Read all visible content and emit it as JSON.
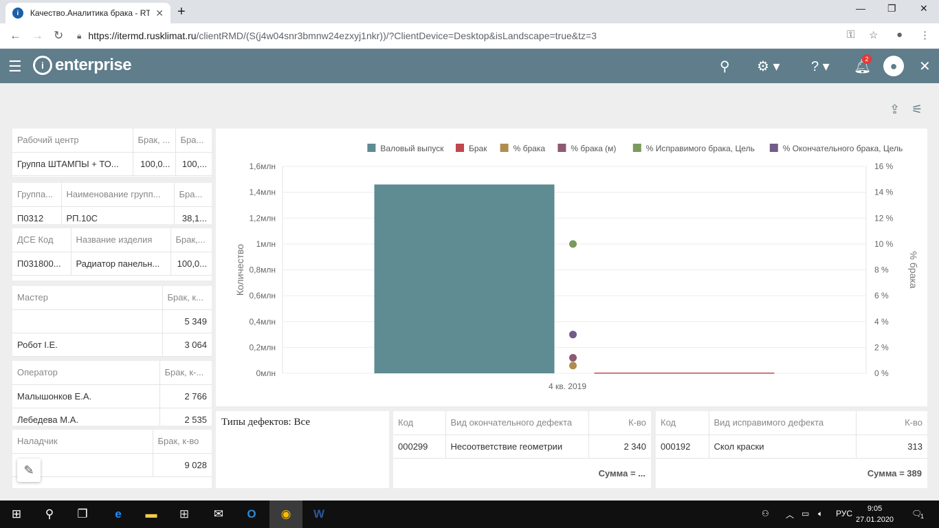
{
  "browser": {
    "tab_title": "Качество.Аналитика брака - RTF",
    "url_host": "https://itermd.rusklimat.ru",
    "url_path": "/clientRMD/(S(j4w04snr3bmnw24ezxyj1nkr))/?ClientDevice=Desktop&isLandscape=true&tz=3"
  },
  "app": {
    "logo_text": "enterprise",
    "notification_count": "2"
  },
  "panels": {
    "work_center": {
      "headers": [
        "Рабочий центр",
        "Брак, ...",
        "Бра..."
      ],
      "rows": [
        [
          "Группа ШТАМПЫ + ТО...",
          "100,0...",
          "100,..."
        ]
      ]
    },
    "group": {
      "headers": [
        "Группа...",
        "Наименование групп...",
        "Бра..."
      ],
      "rows": [
        [
          "П0312",
          "РП.10С",
          "38,1..."
        ]
      ]
    },
    "dse": {
      "headers": [
        "ДСЕ Код",
        "Название изделия",
        "Брак,..."
      ],
      "rows": [
        [
          "П031800...",
          "Радиатор панельн...",
          "100,0..."
        ]
      ]
    },
    "master": {
      "headers": [
        "Мастер",
        "Брак, к..."
      ],
      "rows": [
        [
          "",
          "5 349"
        ],
        [
          "Робот I.E.",
          "3 064"
        ]
      ]
    },
    "operator": {
      "headers": [
        "Оператор",
        "Брак, к-..."
      ],
      "rows": [
        [
          "Малышонков Е.А.",
          "2 766"
        ],
        [
          "Лебедева М.А.",
          "2 535"
        ]
      ]
    },
    "adjuster": {
      "headers": [
        "Наладчик",
        "Брак, к-во"
      ],
      "rows": [
        [
          "",
          "9 028"
        ]
      ]
    }
  },
  "filter": {
    "text": "Типы дефектов: Все"
  },
  "final_defects": {
    "headers": [
      "Код",
      "Вид окончательного дефекта",
      "К-во"
    ],
    "rows": [
      [
        "000299",
        "Несоответствие геометрии",
        "2 340"
      ]
    ],
    "sum": "Сумма = ..."
  },
  "fixable_defects": {
    "headers": [
      "Код",
      "Вид исправимого дефекта",
      "К-во"
    ],
    "rows": [
      [
        "000192",
        "Скол краски",
        "313"
      ]
    ],
    "sum": "Сумма = 389"
  },
  "chart_data": {
    "type": "bar",
    "categories": [
      "4 кв. 2019"
    ],
    "ylabel": "Количество",
    "y2label": "% брака",
    "ylim": [
      0,
      1600000
    ],
    "y2lim": [
      0,
      16
    ],
    "y_ticks": [
      "0млн",
      "0,2млн",
      "0,4млн",
      "0,6млн",
      "0,8млн",
      "1млн",
      "1,2млн",
      "1,4млн",
      "1,6млн"
    ],
    "y2_ticks": [
      "0 %",
      "2 %",
      "4 %",
      "6 %",
      "8 %",
      "10 %",
      "12 %",
      "14 %",
      "16 %"
    ],
    "legend_position": "top-right",
    "series": [
      {
        "name": "Валовый выпуск",
        "kind": "bar",
        "axis": "left",
        "values": [
          1460000
        ],
        "color": "#5f8b93"
      },
      {
        "name": "Брак",
        "kind": "bar",
        "axis": "left",
        "values": [
          5349
        ],
        "color": "#c0474e"
      },
      {
        "name": "% брака",
        "kind": "point",
        "axis": "right",
        "values": [
          0.6
        ],
        "color": "#b08d4e"
      },
      {
        "name": "% брака (м)",
        "kind": "point",
        "axis": "right",
        "values": [
          1.2
        ],
        "color": "#8c5a72"
      },
      {
        "name": "% Исправимого брака, Цель",
        "kind": "point",
        "axis": "right",
        "values": [
          10
        ],
        "color": "#7a9a5e"
      },
      {
        "name": "% Окончательного брака, Цель",
        "kind": "point",
        "axis": "right",
        "values": [
          3
        ],
        "color": "#725c88"
      }
    ]
  },
  "taskbar": {
    "lang": "РУС",
    "time": "9:05",
    "date": "27.01.2020",
    "notif": "1"
  }
}
